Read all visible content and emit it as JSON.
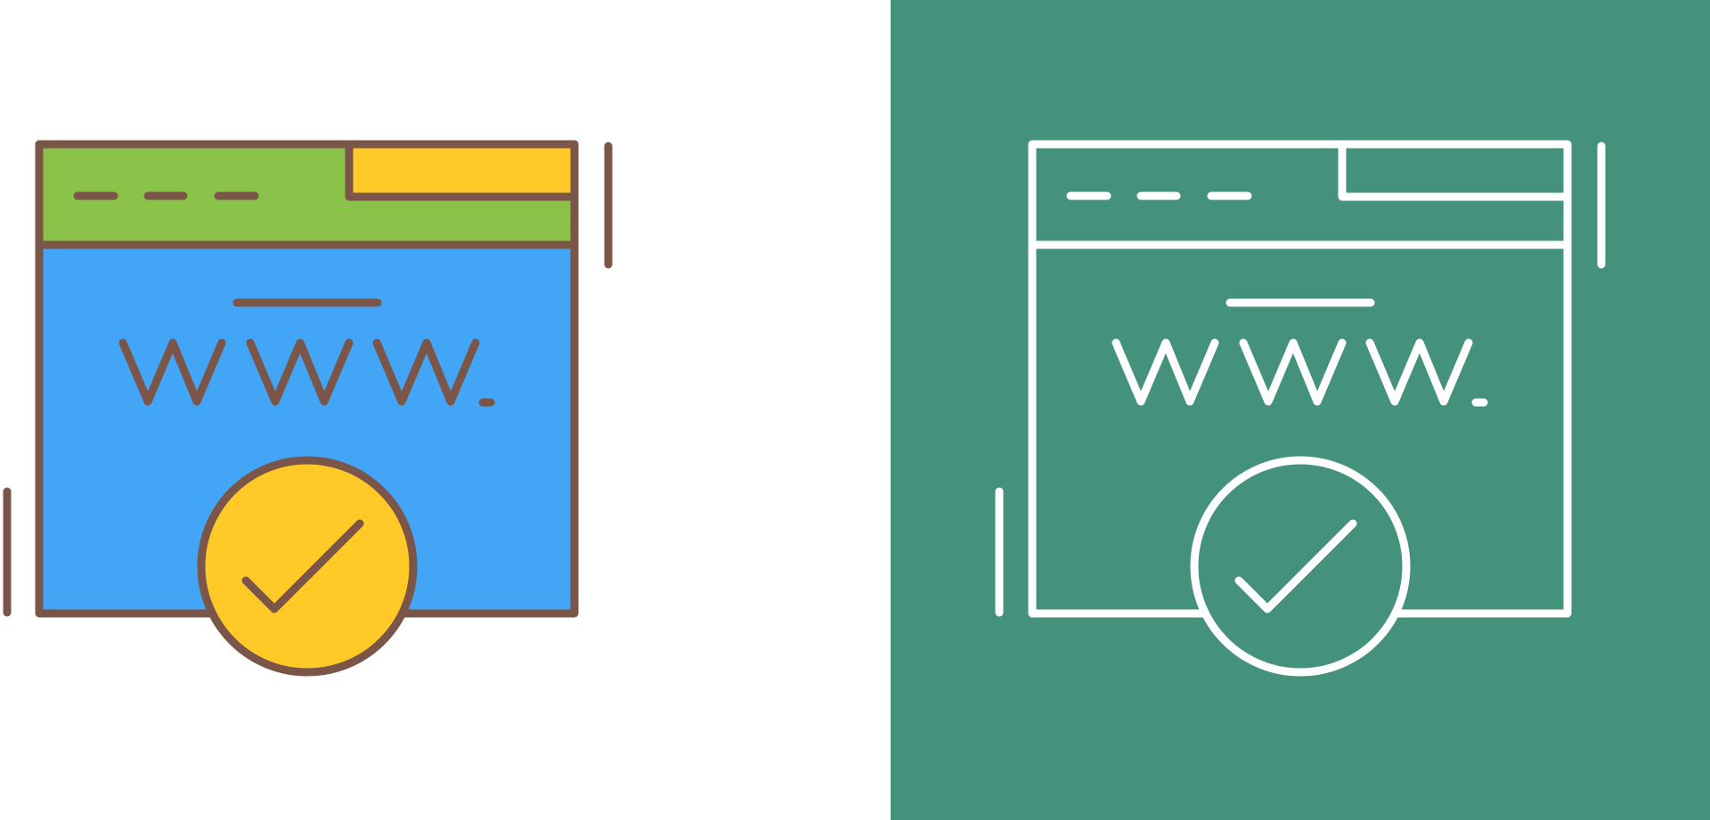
{
  "icon_set": {
    "name": "verified-website-icon",
    "colors": {
      "outline": "#7A5548",
      "header_green": "#8BC34A",
      "tab_yellow": "#FFCA28",
      "body_blue": "#42A5F5",
      "badge_yellow": "#FFCA28",
      "background_white": "#FFFFFF",
      "background_teal": "#45927C",
      "line_white": "#FFFFFF"
    },
    "variants": [
      {
        "style": "filled-color",
        "icon": "verified-website-icon"
      },
      {
        "style": "line-white",
        "icon": "verified-website-icon"
      }
    ]
  }
}
